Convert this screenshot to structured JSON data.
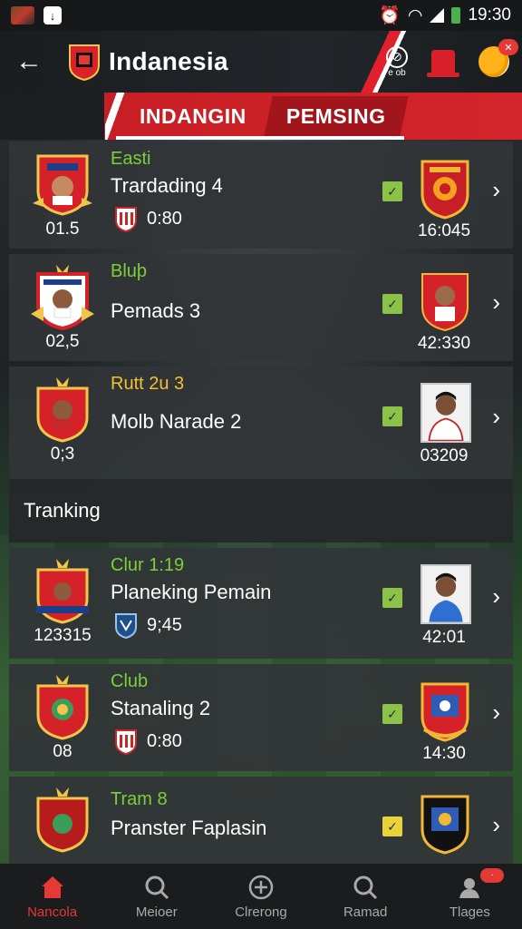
{
  "status_bar": {
    "time": "19:30"
  },
  "header": {
    "title": "Indanesia",
    "coin_action_label": "e ob"
  },
  "tabs": [
    {
      "label": "INDANGIN"
    },
    {
      "label": "PEMSING"
    }
  ],
  "matches": [
    {
      "left_num": "01.5",
      "subtitle": "Easti",
      "title": "Trardading 4",
      "mini_value": "0:80",
      "right_num": "16:045",
      "check_color": "green"
    },
    {
      "left_num": "02,5",
      "subtitle": "Bluþ",
      "title": "Pemads 3",
      "mini_value": "",
      "right_num": "42:330",
      "check_color": "green"
    },
    {
      "left_num": "0;3",
      "subtitle": "Rutt 2u 3",
      "title": "Molb Narade 2",
      "mini_value": "",
      "right_num": "03209",
      "check_color": "green"
    }
  ],
  "section": {
    "title": "Tranking"
  },
  "rankings": [
    {
      "left_num": "123315",
      "subtitle": "Clur 1:19",
      "title": "Planeking Pemain",
      "mini_value": "9;45",
      "right_num": "42:01",
      "check_color": "green"
    },
    {
      "left_num": "08",
      "subtitle": "Club",
      "title": "Stanaling 2",
      "mini_value": "0:80",
      "right_num": "14:30",
      "check_color": "green"
    },
    {
      "left_num": "",
      "subtitle": "Tram 8",
      "title": "Pranster Faplasin",
      "mini_value": "",
      "right_num": "",
      "check_color": "yellow"
    }
  ],
  "bottom_nav": [
    {
      "label": "Nancola",
      "icon": "home-icon",
      "active": true
    },
    {
      "label": "Meioer",
      "icon": "search-icon",
      "active": false
    },
    {
      "label": "Clrerong",
      "icon": "plus-circle-icon",
      "active": false
    },
    {
      "label": "Ramad",
      "icon": "search-icon",
      "active": false
    },
    {
      "label": "Tlages",
      "icon": "profile-icon",
      "active": false,
      "badge": "·"
    }
  ],
  "colors": {
    "accent_red": "#d4242b",
    "accent_green": "#7ccf3a",
    "accent_yellow": "#f2c230"
  }
}
